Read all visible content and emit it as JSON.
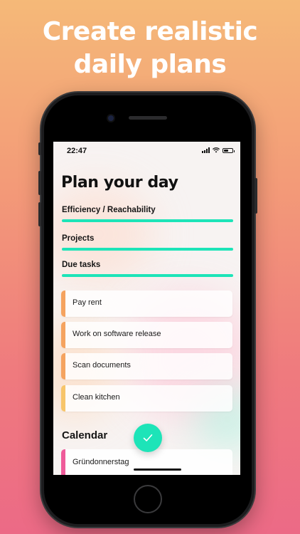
{
  "headline": {
    "line1": "Create realistic",
    "line2": "daily plans"
  },
  "status_bar": {
    "time": "22:47"
  },
  "page_title": "Plan your day",
  "sections": [
    {
      "label": "Efficiency / Reachability"
    },
    {
      "label": "Projects"
    },
    {
      "label": "Due tasks"
    }
  ],
  "tasks": [
    {
      "label": "Pay rent",
      "color": "#f5a35f"
    },
    {
      "label": "Work on software release",
      "color": "#f5a35f"
    },
    {
      "label": "Scan documents",
      "color": "#f5a35f"
    },
    {
      "label": "Clean kitchen",
      "color": "#f7c56a"
    }
  ],
  "calendar": {
    "title": "Calendar",
    "items": [
      {
        "label": "Gründonnerstag",
        "color": "#ef5b9a"
      }
    ]
  },
  "colors": {
    "accent": "#1de4b8",
    "background_top": "#f5b978",
    "background_bottom": "#ec6a86"
  },
  "icons": {
    "confirm": "checkmark-icon",
    "signal": "signal-icon",
    "wifi": "wifi-icon",
    "battery": "battery-icon"
  }
}
